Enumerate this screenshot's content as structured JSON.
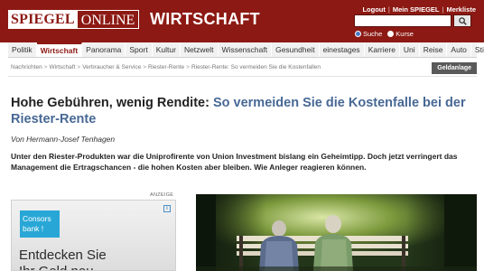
{
  "header": {
    "logo_left": "SPIEGEL",
    "logo_right": "ONLINE",
    "ressort": "WIRTSCHAFT",
    "service_links": [
      "Logout",
      "Mein SPIEGEL",
      "Merkliste"
    ],
    "search": {
      "placeholder": "",
      "button_icon": "search-icon",
      "options": [
        "Suche",
        "Kurse"
      ],
      "selected": "Suche"
    }
  },
  "nav": {
    "items": [
      "Politik",
      "Wirtschaft",
      "Panorama",
      "Sport",
      "Kultur",
      "Netzwelt",
      "Wissenschaft",
      "Gesundheit",
      "einestages",
      "Karriere",
      "Uni",
      "Reise",
      "Auto",
      "Stil"
    ],
    "active": "Wirtschaft"
  },
  "breadcrumb": {
    "items": [
      "Nachrichten",
      "Wirtschaft",
      "Verbraucher & Service",
      "Riester-Rente",
      "Riester-Rente: So vermeiden Sie die Kostenfallen"
    ],
    "separator": ">",
    "section_button": "Geldanlage"
  },
  "article": {
    "kicker": "Hohe Gebühren, wenig Rendite:",
    "title": "So vermeiden Sie die Kostenfalle bei der Riester-Rente",
    "author": "Von Hermann-Josef Tenhagen",
    "lead": "Unter den Riester-Produkten war die Uniprofirente von Union Investment bislang ein Geheimtipp. Doch jetzt verringert das Management die Ertragschancen - die hohen Kosten aber bleiben. Wie Anleger reagieren können."
  },
  "ad": {
    "label": "ANZEIGE",
    "brand_line1": "Consors",
    "brand_line2": "bank !",
    "headline": "Entdecken Sie",
    "headline_cutoff": "Ihr Geld neu"
  },
  "colors": {
    "brand_red": "#8c1913",
    "headline_blue": "#476895",
    "ad_blue": "#28a7d6"
  }
}
